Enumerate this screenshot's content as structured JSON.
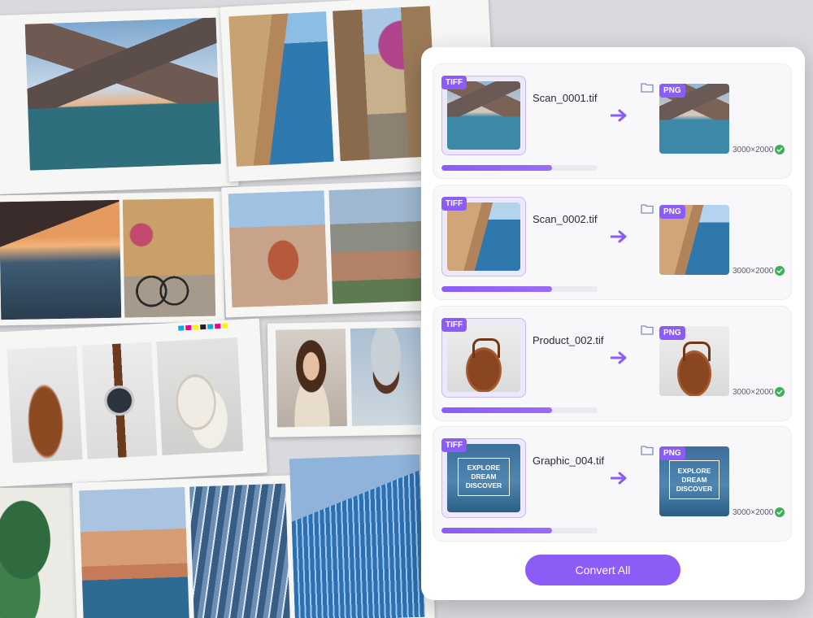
{
  "panel": {
    "jobs": [
      {
        "source_format": "TIFF",
        "filename": "Scan_0001.tif",
        "target_format": "PNG",
        "dimensions": "3000×2000",
        "progress": 0.71,
        "scene": "lake",
        "status": "complete"
      },
      {
        "source_format": "TIFF",
        "filename": "Scan_0002.tif",
        "target_format": "PNG",
        "dimensions": "3000×2000",
        "progress": 0.71,
        "scene": "coast",
        "status": "complete"
      },
      {
        "source_format": "TIFF",
        "filename": "Product_002.tif",
        "target_format": "PNG",
        "dimensions": "3000×2000",
        "progress": 0.71,
        "scene": "bag",
        "status": "complete"
      },
      {
        "source_format": "TIFF",
        "filename": "Graphic_004.tif",
        "target_format": "PNG",
        "dimensions": "3000×2000",
        "progress": 0.71,
        "scene": "graphic",
        "status": "complete",
        "graphic_text": [
          "EXPLORE",
          "DREAM",
          "DISCOVER"
        ]
      }
    ],
    "convert_button_label": "Convert All"
  },
  "icons": {
    "arrow": "arrow-right-icon",
    "folder": "folder-icon",
    "check": "check-circle-icon"
  },
  "colors": {
    "accent": "#8b5cf6",
    "success": "#3fae5a"
  }
}
